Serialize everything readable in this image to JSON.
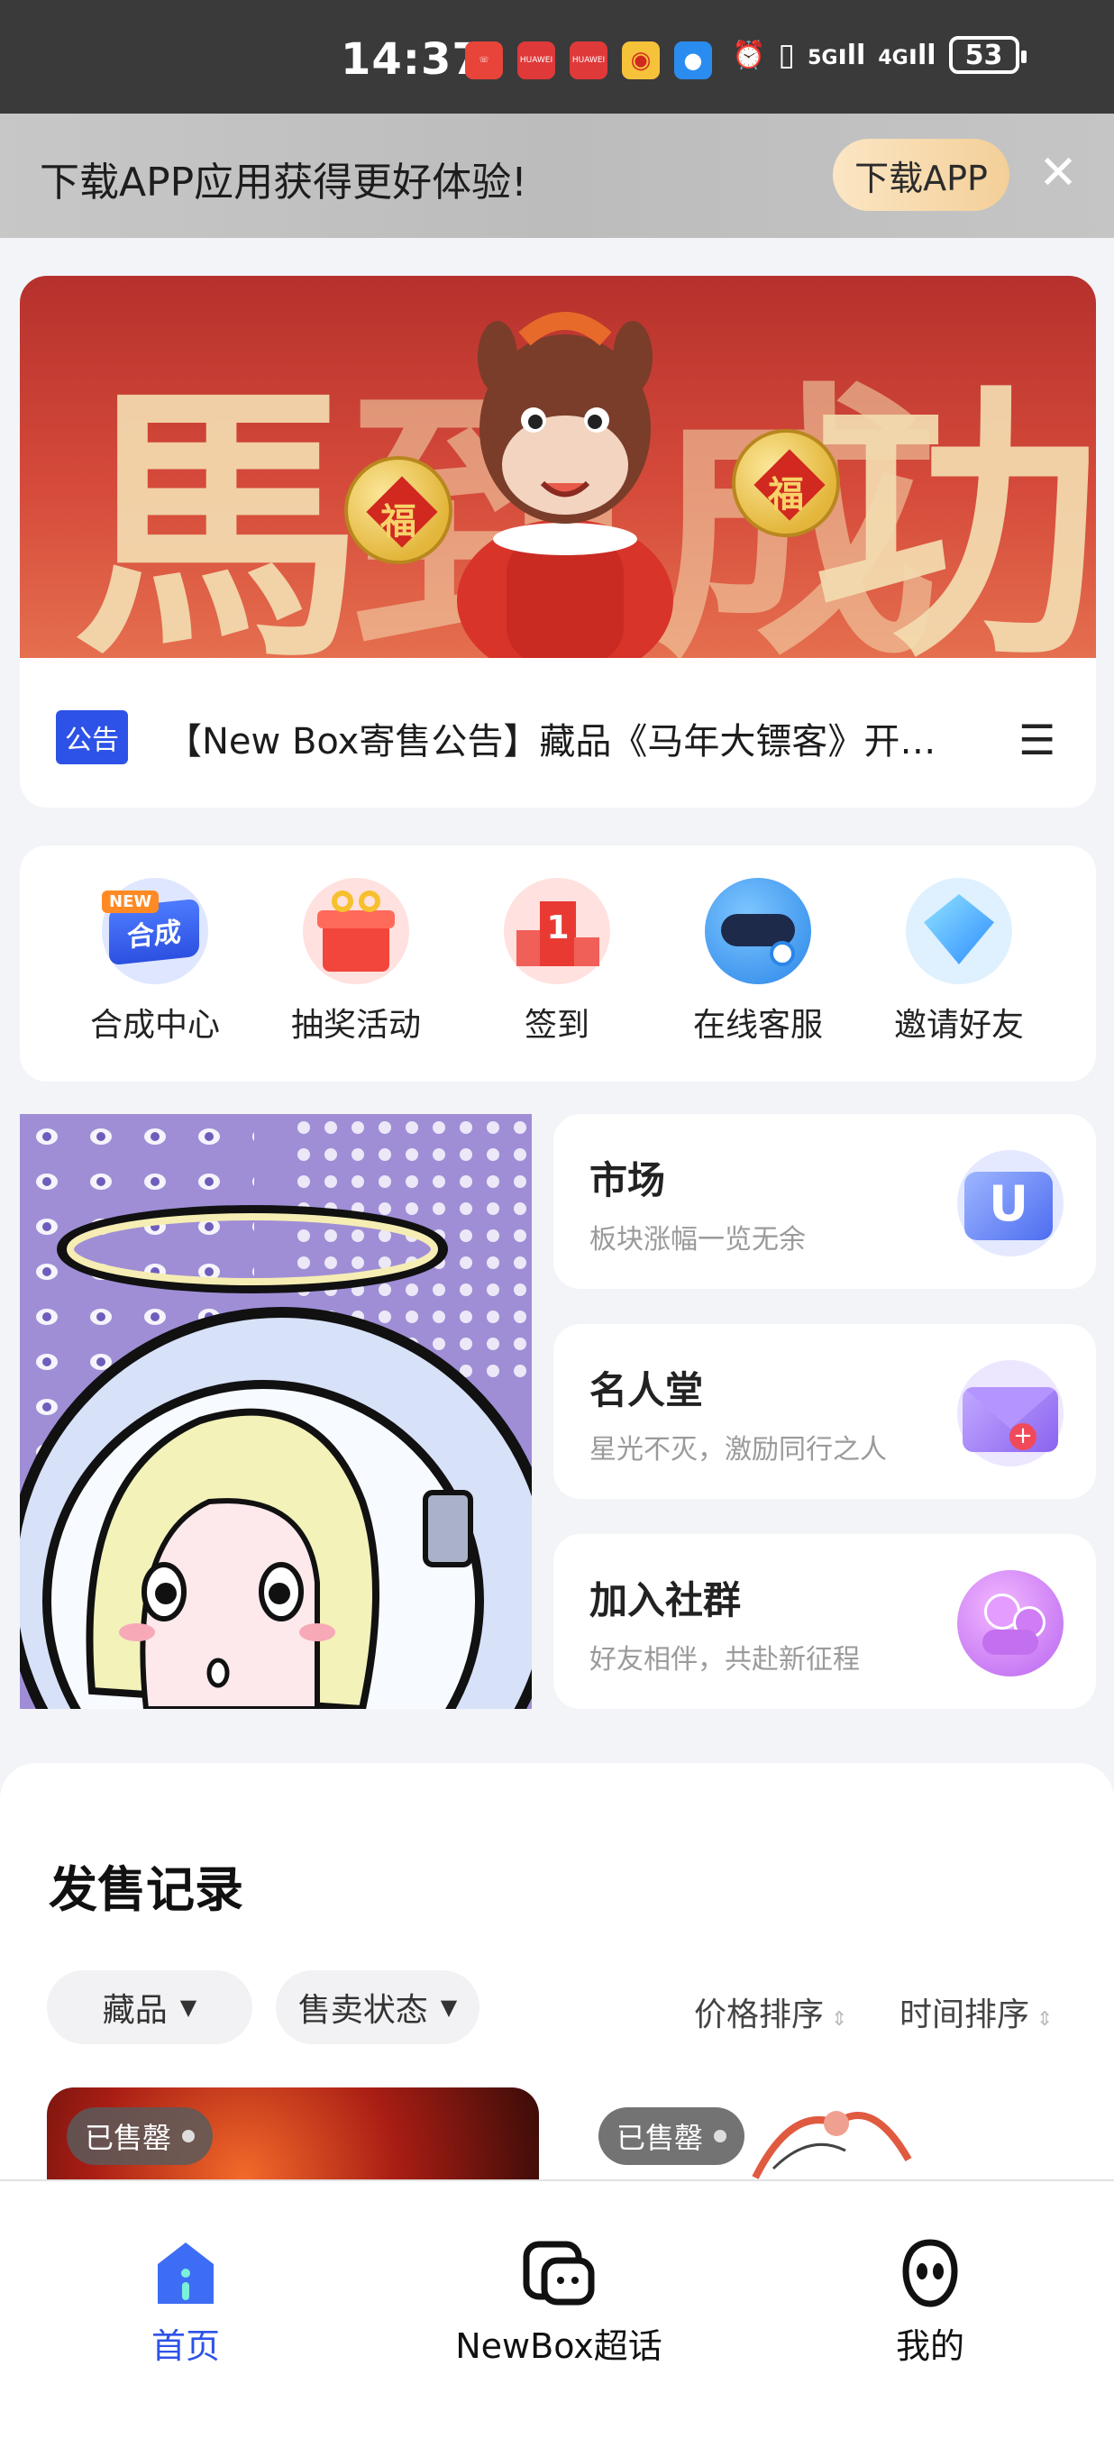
{
  "status_bar": {
    "time": "14:37",
    "battery": "53",
    "net1": "5G",
    "net2": "4G"
  },
  "download_bar": {
    "message": "下载APP应用获得更好体验!",
    "button": "下载APP"
  },
  "banner": {
    "notice_tag": "公告",
    "notice_text": "【New Box寄售公告】藏品《马年大镖客》开…",
    "chars": [
      "馬",
      "到",
      "成",
      "功"
    ],
    "lantern_char": "福"
  },
  "quick_menu": [
    {
      "label": "合成中心",
      "icon": "synthesis-new-icon",
      "badge": "NEW",
      "badge_text": "合成"
    },
    {
      "label": "抽奖活动",
      "icon": "gift-box-icon"
    },
    {
      "label": "签到",
      "icon": "checkin-podium-icon",
      "badge_text": "1"
    },
    {
      "label": "在线客服",
      "icon": "headset-service-icon"
    },
    {
      "label": "邀请好友",
      "icon": "diamond-invite-icon"
    }
  ],
  "features": [
    {
      "title": "市场",
      "subtitle": "板块涨幅一览无余",
      "icon": "market-cube-icon"
    },
    {
      "title": "名人堂",
      "subtitle": "星光不灭，激励同行之人",
      "icon": "envelope-icon"
    },
    {
      "title": "加入社群",
      "subtitle": "好友相伴，共赴新征程",
      "icon": "community-bubbles-icon"
    }
  ],
  "sales": {
    "title": "发售记录",
    "filters": [
      {
        "label": "藏品"
      },
      {
        "label": "售卖状态"
      }
    ],
    "sorts": [
      {
        "label": "价格排序"
      },
      {
        "label": "时间排序"
      }
    ],
    "items": [
      {
        "status": "已售罄"
      },
      {
        "status": "已售罄"
      }
    ]
  },
  "bottom_nav": [
    {
      "label": "首页",
      "icon": "home-icon",
      "active": true
    },
    {
      "label": "NewBox超话",
      "icon": "chat-topic-icon",
      "active": false
    },
    {
      "label": "我的",
      "icon": "profile-icon",
      "active": false
    }
  ],
  "colors": {
    "accent": "#2d52e8",
    "banner_red": "#c83a30",
    "status_bar": "#3a3a3a"
  }
}
